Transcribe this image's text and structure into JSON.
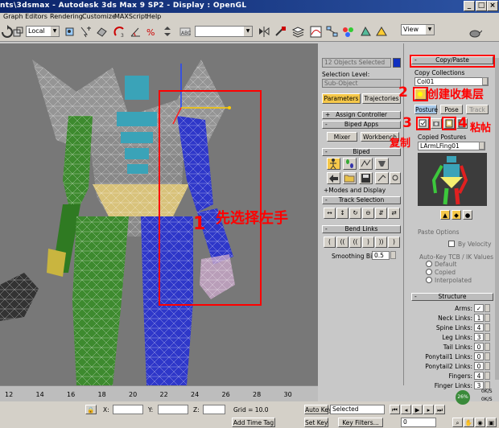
{
  "window": {
    "title": "nts\\3dsmax   -   Autodesk 3ds Max 9 SP2   -   Display : OpenGL",
    "minimize": "_",
    "maximize": "□",
    "close": "×"
  },
  "menu": {
    "items": [
      "Graph Editors",
      "Rendering",
      "Customize",
      "MAXScript",
      "Help"
    ]
  },
  "toolbar": {
    "coord_system": "Local",
    "named_selection": "",
    "view": "View"
  },
  "panel_left": {
    "selected_count": "12 Objects Selected",
    "selection_level_label": "Selection Level:",
    "sub_object": "Sub-Object",
    "tabs": [
      "Parameters",
      "Trajectories"
    ],
    "rollouts": {
      "assign_controller": "Assign Controller",
      "biped_apps": "Biped Apps",
      "mixer": "Mixer",
      "workbench": "Workbench",
      "biped": "Biped",
      "modes_display": "+Modes and Display",
      "track_selection": "Track Selection",
      "bend_links": "Bend Links",
      "smoothing_bias_label": "Smoothing Bias:",
      "smoothing_bias_value": "0.5"
    }
  },
  "panel_right": {
    "copy_paste": "Copy/Paste",
    "copy_collections": "Copy Collections",
    "collection_name": "Col01",
    "tabs": [
      "Posture",
      "Pose",
      "Track"
    ],
    "copied_postures_label": "Copied Postures",
    "posture_name": "LArmLFing01",
    "paste_options": "Paste Options",
    "by_velocity": "By Velocity",
    "autokey_label": "Auto-Key TCB / IK Values",
    "radio": [
      "Default",
      "Copied",
      "Interpolated"
    ],
    "structure": "Structure",
    "structure_rows": [
      {
        "label": "Arms:",
        "value": "✓"
      },
      {
        "label": "Neck Links:",
        "value": "1"
      },
      {
        "label": "Spine Links:",
        "value": "4"
      },
      {
        "label": "Leg Links:",
        "value": "3"
      },
      {
        "label": "Tail Links:",
        "value": "0"
      },
      {
        "label": "Ponytail1 Links:",
        "value": "0"
      },
      {
        "label": "Ponytail2 Links:",
        "value": "0"
      },
      {
        "label": "Fingers:",
        "value": "4"
      },
      {
        "label": "Finger Links:",
        "value": "3"
      }
    ]
  },
  "annotations": {
    "step1": "1",
    "step1_text": "先选择左手",
    "step2": "2",
    "step2_text": "创建收集层",
    "step3": "3",
    "step3_text": "复制",
    "step4": "4",
    "step4_text": "粘帖"
  },
  "timeline": {
    "ticks": [
      "12",
      "14",
      "16",
      "18",
      "20",
      "22",
      "24",
      "26",
      "28",
      "30"
    ]
  },
  "status": {
    "x_label": "X:",
    "y_label": "Y:",
    "z_label": "Z:",
    "grid": "Grid = 10.0",
    "add_time_tag": "Add Time Tag",
    "auto_key": "Auto Key",
    "set_key": "Set Key",
    "selected": "Selected",
    "key_filters": "Key Filters...",
    "frame": "0",
    "net_percent": "26%",
    "net_up": "0K/S",
    "net_down": "0K/S"
  },
  "colors": {
    "annotation": "#ff0000",
    "active_button": "#f6c84a",
    "title_bar": "#0a246a"
  }
}
